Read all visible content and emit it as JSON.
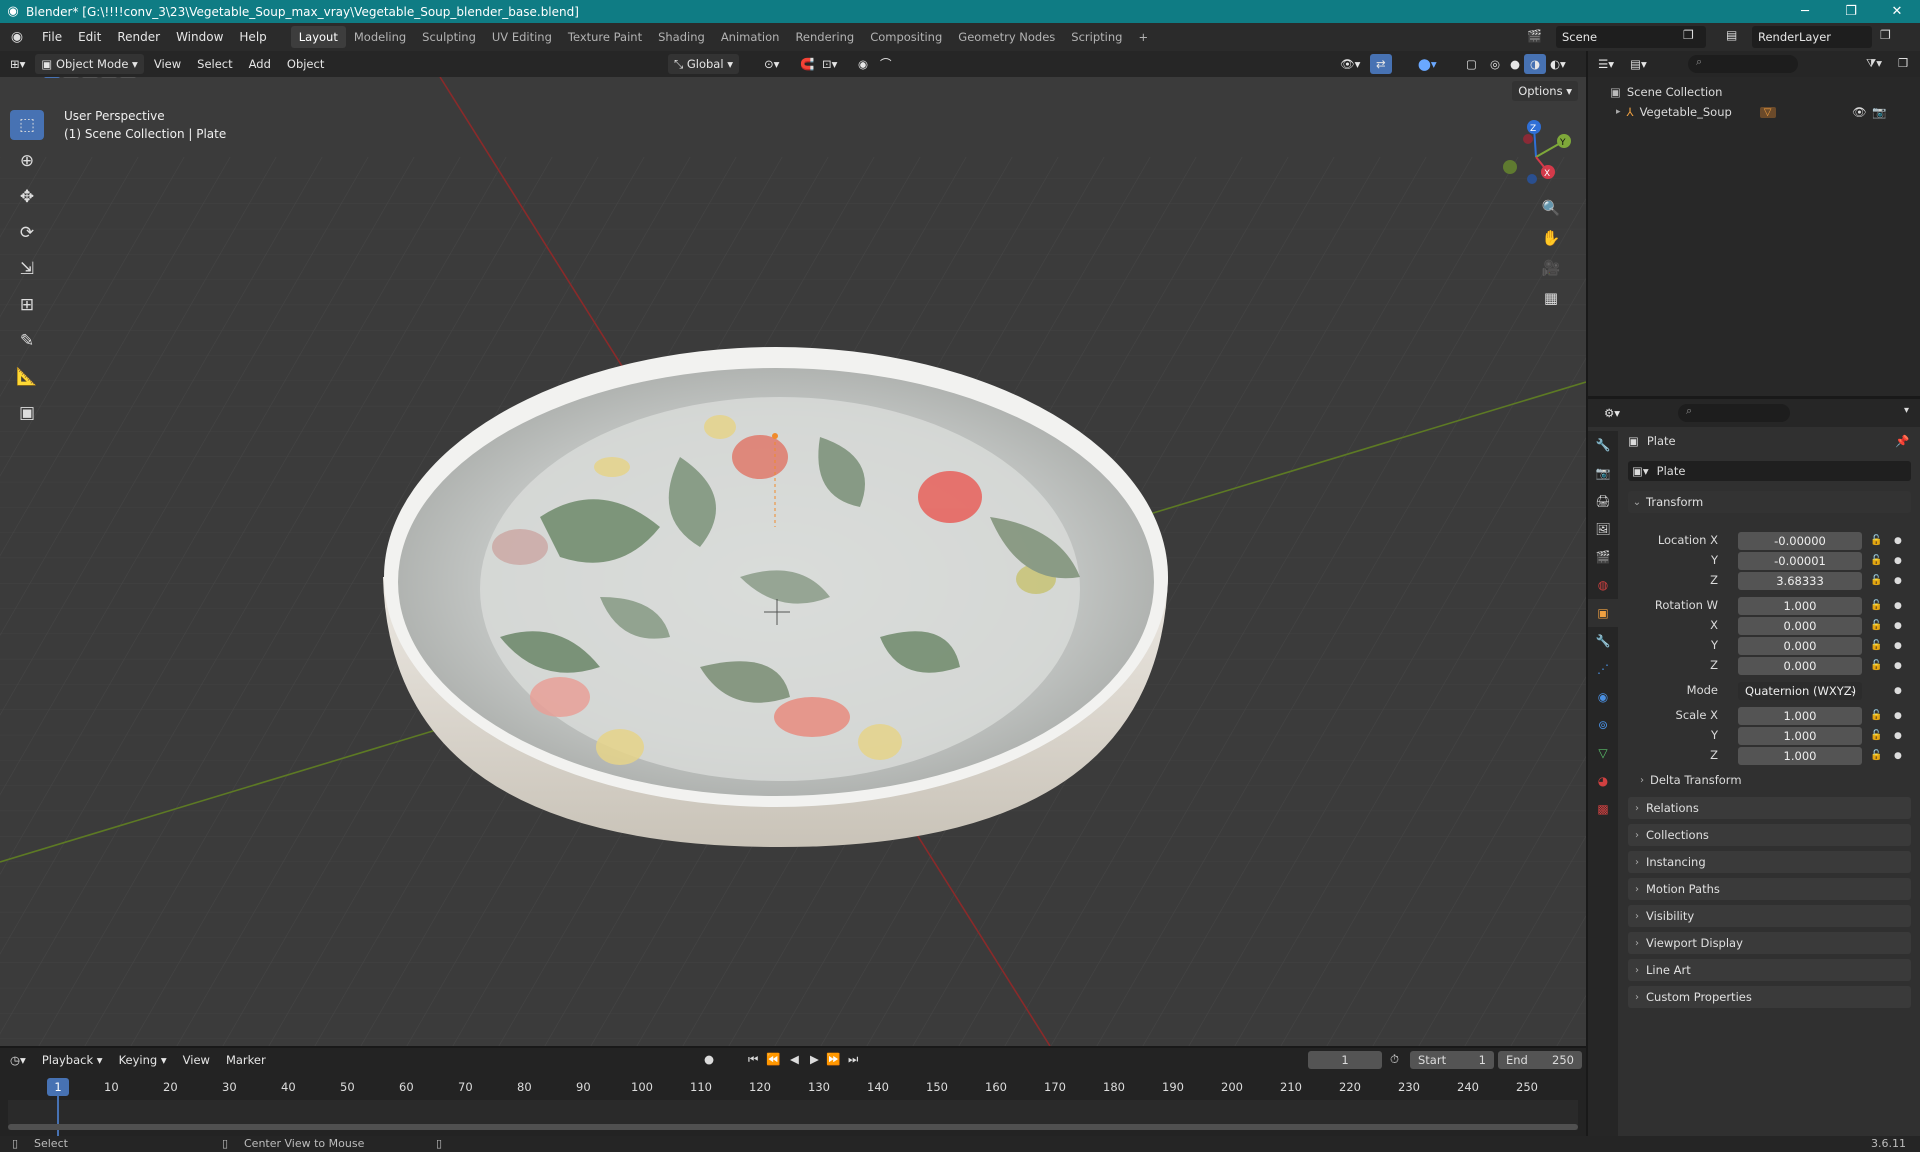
{
  "titlebar": {
    "title": "Blender* [G:\\!!!!conv_3\\23\\Vegetable_Soup_max_vray\\Vegetable_Soup_blender_base.blend]",
    "minimize": "─",
    "maximize": "❐",
    "close": "✕"
  },
  "menu": [
    "File",
    "Edit",
    "Render",
    "Window",
    "Help"
  ],
  "workspaces": [
    "Layout",
    "Modeling",
    "Sculpting",
    "UV Editing",
    "Texture Paint",
    "Shading",
    "Animation",
    "Rendering",
    "Compositing",
    "Geometry Nodes",
    "Scripting",
    "+"
  ],
  "scene": {
    "name": "Scene",
    "render_layer": "RenderLayer"
  },
  "viewport_header": {
    "mode": "Object Mode",
    "view": "View",
    "select": "Select",
    "add": "Add",
    "object": "Object",
    "transform_orientation": "Global",
    "options": "Options"
  },
  "viewport": {
    "perspective": "User Perspective",
    "collection_info": "(1) Scene Collection | Plate"
  },
  "gizmo": {
    "z": "Z",
    "y": "Y",
    "x": "X"
  },
  "outliner": {
    "root": "Scene Collection",
    "items": [
      {
        "name": "Vegetable_Soup"
      }
    ]
  },
  "properties": {
    "object_name": "Plate",
    "data_name": "Plate",
    "transform_label": "Transform",
    "location": {
      "label": "Location X",
      "x": "-0.00000",
      "y": "-0.00001",
      "z": "3.68333"
    },
    "rotation": {
      "label": "Rotation W",
      "w": "1.000",
      "x": "0.000",
      "y": "0.000",
      "z": "0.000"
    },
    "mode": {
      "label": "Mode",
      "value": "Quaternion (WXYZ)"
    },
    "scale": {
      "label": "Scale X",
      "x": "1.000",
      "y": "1.000",
      "z": "1.000"
    },
    "axis_y": "Y",
    "axis_z": "Z",
    "axis_x": "X",
    "delta_transform": "Delta Transform",
    "panels": [
      "Relations",
      "Collections",
      "Instancing",
      "Motion Paths",
      "Visibility",
      "Viewport Display",
      "Line Art",
      "Custom Properties"
    ]
  },
  "timeline": {
    "playback": "Playback",
    "keying": "Keying",
    "view": "View",
    "marker": "Marker",
    "current_frame": "1",
    "start_label": "Start",
    "start": "1",
    "end_label": "End",
    "end": "250",
    "ticks": [
      "10",
      "20",
      "30",
      "40",
      "50",
      "60",
      "70",
      "80",
      "90",
      "100",
      "110",
      "120",
      "130",
      "140",
      "150",
      "160",
      "170",
      "180",
      "190",
      "200",
      "210",
      "220",
      "230",
      "240",
      "250"
    ],
    "cursor_frame": "1"
  },
  "statusbar": {
    "select": "Select",
    "center_view": "Center View to Mouse",
    "version": "3.6.11"
  }
}
